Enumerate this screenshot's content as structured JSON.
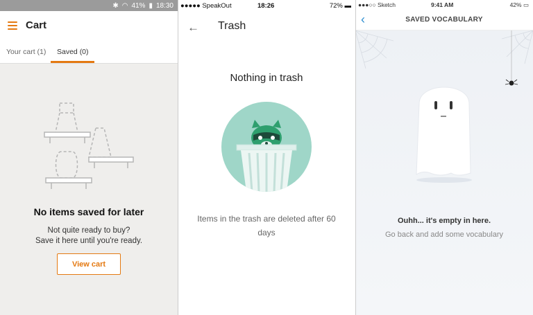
{
  "cart_app": {
    "status_bar": {
      "battery": "41%",
      "time": "18:30"
    },
    "title": "Cart",
    "tabs": [
      {
        "label": "Your cart (1)"
      },
      {
        "label": "Saved (0)"
      }
    ],
    "empty_title": "No items saved for later",
    "empty_line1": "Not quite ready to buy?",
    "empty_line2": "Save it here until you're ready.",
    "view_cart_label": "View cart",
    "accent_color": "#e47911"
  },
  "trash_app": {
    "status_bar": {
      "carrier": "●●●●● SpeakOut",
      "time": "18:26",
      "battery": "72%"
    },
    "title": "Trash",
    "empty_title": "Nothing in trash",
    "empty_message": "Items in the trash are deleted after 60 days",
    "illustration_color": "#9fd6c8"
  },
  "vocab_app": {
    "status_bar": {
      "carrier": "●●●○○ Sketch",
      "time": "9:41 AM",
      "battery": "42%"
    },
    "title": "SAVED VOCABULARY",
    "empty_title": "Ouhh... it's empty in here.",
    "empty_message": "Go back and add some vocabulary",
    "accent_color": "#2f8fd1"
  }
}
